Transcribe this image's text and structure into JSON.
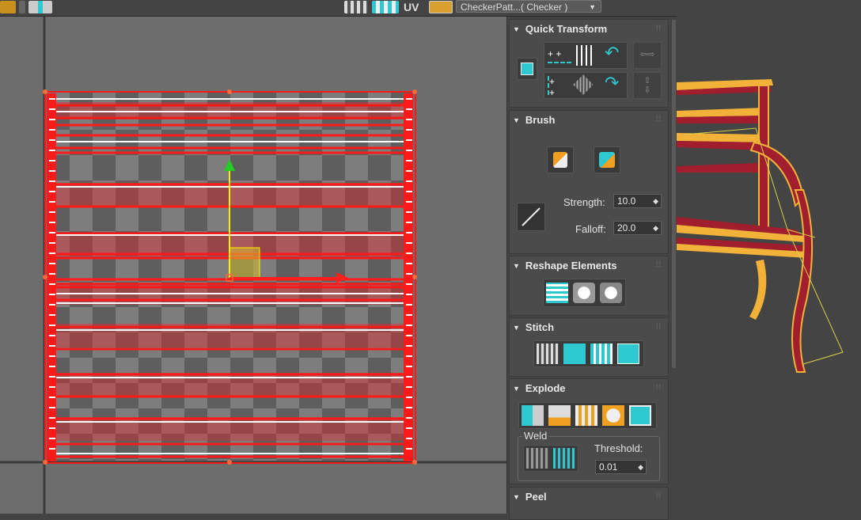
{
  "toolbar": {
    "uv_label": "UV",
    "map_dropdown": "CheckerPatt...( Checker )"
  },
  "panel": {
    "quick_transform": {
      "title": "Quick Transform"
    },
    "brush": {
      "title": "Brush",
      "strength_label": "Strength:",
      "strength_value": "10.0",
      "falloff_label": "Falloff:",
      "falloff_value": "20.0"
    },
    "reshape": {
      "title": "Reshape Elements"
    },
    "stitch": {
      "title": "Stitch"
    },
    "explode": {
      "title": "Explode",
      "weld_label": "Weld",
      "threshold_label": "Threshold:",
      "threshold_value": "0.01"
    },
    "peel": {
      "title": "Peel"
    }
  },
  "colors": {
    "uv_wire": "#ff1a1a",
    "gizmo_y": "#ffee00",
    "gizmo_x": "#ff2020",
    "gizmo_up": "#22cc22",
    "accent_cyan": "#2ec8d0",
    "accent_orange": "#f0a020"
  },
  "icons": {
    "quick_transform": [
      "pivot-icon",
      "align-horizontal-icon",
      "space-vertical-icon",
      "rotate-ccw-icon",
      "align-vertical-icon",
      "straighten-icon",
      "rotate-cw-icon"
    ],
    "brush": [
      "relax-brush-icon",
      "pin-brush-icon",
      "line-brush-icon"
    ],
    "reshape": [
      "straighten-selection-icon",
      "relax-icon",
      "relax-settings-icon"
    ],
    "stitch": [
      "stitch-custom-icon",
      "stitch-source-icon",
      "stitch-average-icon",
      "stitch-target-icon"
    ],
    "explode": [
      "break-icon",
      "flatten-by-smoothing-icon",
      "flatten-by-material-icon",
      "flatten-custom-icon",
      "flatten-all-icon",
      "weld-selected-icon",
      "weld-target-icon"
    ]
  }
}
